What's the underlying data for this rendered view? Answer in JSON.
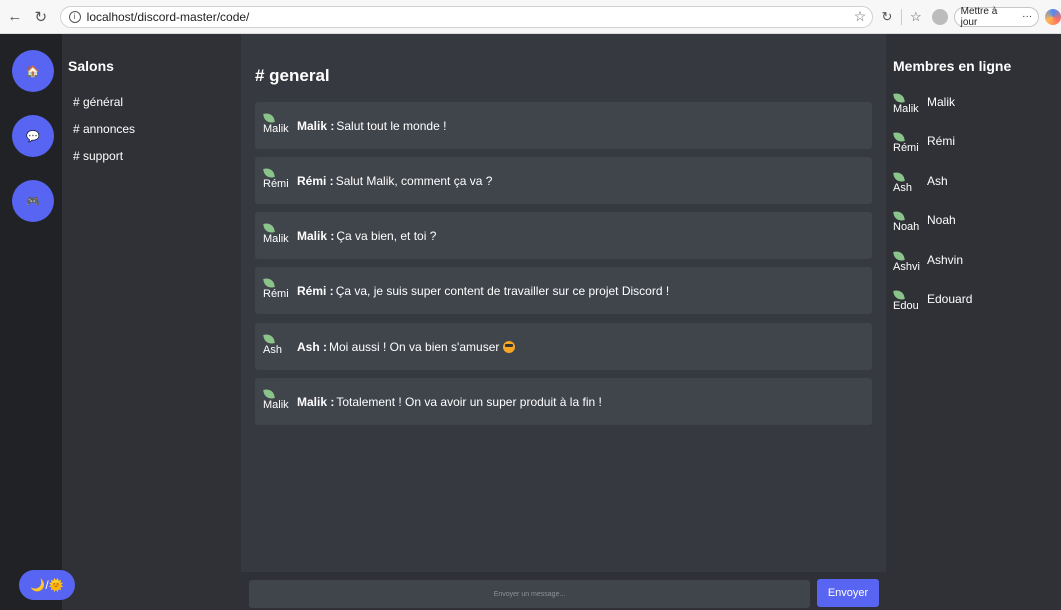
{
  "browser": {
    "url": "localhost/discord-master/code/",
    "update_label": "Mettre à jour",
    "more_label": "···"
  },
  "servers": [
    {
      "icon": "house-icon",
      "emoji": "🏠"
    },
    {
      "icon": "chat-bubble-icon",
      "emoji": "💬"
    },
    {
      "icon": "gamepad-icon",
      "emoji": "🎮"
    }
  ],
  "theme_toggle": {
    "label": "🌙/🌞"
  },
  "channels": {
    "title": "Salons",
    "items": [
      {
        "label": "# général"
      },
      {
        "label": "# annonces"
      },
      {
        "label": "# support"
      }
    ]
  },
  "chat": {
    "title": "# general",
    "messages": [
      {
        "avatar_alt": "Malik",
        "author": "Malik :",
        "text": "Salut tout le monde !"
      },
      {
        "avatar_alt": "Rémi",
        "author": "Rémi :",
        "text": "Salut Malik, comment ça va ?"
      },
      {
        "avatar_alt": "Malik",
        "author": "Malik :",
        "text": "Ça va bien, et toi ?"
      },
      {
        "avatar_alt": "Rémi",
        "author": "Rémi :",
        "text": "Ça va, je suis super content de travailler sur ce projet Discord !"
      },
      {
        "avatar_alt": "Ash",
        "author": "Ash :",
        "text": "Moi aussi ! On va bien s'amuser"
      },
      {
        "avatar_alt": "Malik",
        "author": "Malik :",
        "text": "Totalement ! On va avoir un super produit à la fin !"
      }
    ],
    "input_placeholder": "Envoyer un message...",
    "send_label": "Envoyer"
  },
  "members": {
    "title": "Membres en ligne",
    "items": [
      {
        "avatar_alt": "Malik",
        "name": "Malik"
      },
      {
        "avatar_alt": "Rémi",
        "name": "Rémi"
      },
      {
        "avatar_alt": "Ash",
        "name": "Ash"
      },
      {
        "avatar_alt": "Noah",
        "name": "Noah"
      },
      {
        "avatar_alt": "Ashvi",
        "name": "Ashvin"
      },
      {
        "avatar_alt": "Edou",
        "name": "Edouard"
      }
    ]
  },
  "colors": {
    "accent": "#5865f2",
    "server_bg": "#202225",
    "sidebar_bg": "#2f3136",
    "chat_bg": "#36393f",
    "message_bg": "#40444b"
  }
}
